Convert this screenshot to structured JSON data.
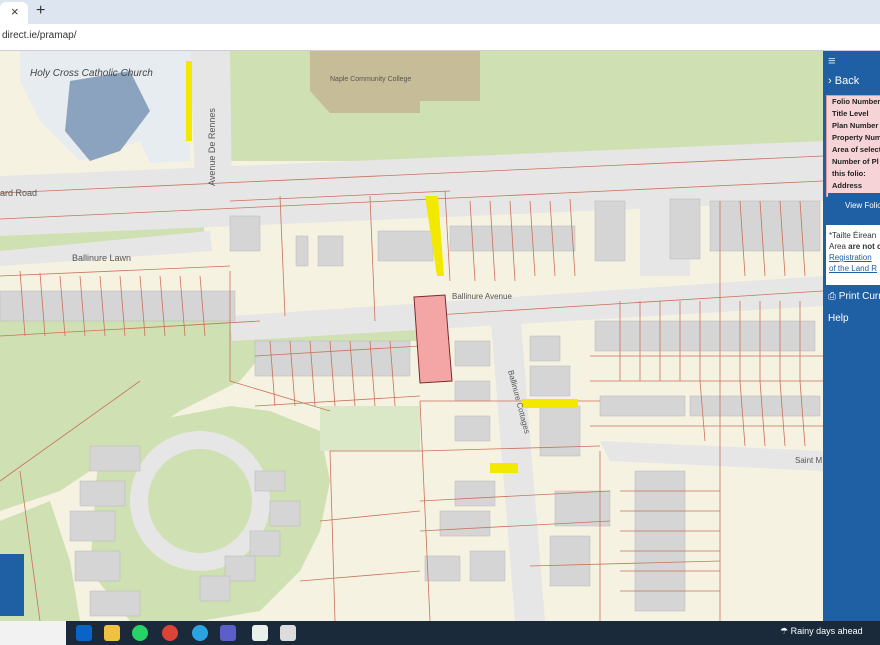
{
  "browser": {
    "tab_close": "×",
    "new_tab": "+",
    "url": "direct.ie/pramap/"
  },
  "map": {
    "labels": {
      "church": "Holy Cross Catholic Church",
      "church_small": "Holy Cross Catholic Church",
      "college": "Naple Community College",
      "road_left": "ard Road",
      "avenue_de_rennes": "Avenue De Rennes",
      "ballinure_lawn": "Ballinure Lawn",
      "ballinure_avenue": "Ballinure Avenue",
      "ballinure_cottages": "Ballinure Cottages",
      "saint_m": "Saint M"
    },
    "colors": {
      "background": "#f6f2e2",
      "green": "#cfe0b2",
      "road": "#e6e6e6",
      "building": "#d5d5d5",
      "parcel_line": "#c9725a",
      "selected": "#f4a6a6",
      "highlight": "#f2e800"
    }
  },
  "panel": {
    "menu_icon": "≡",
    "back": "Back",
    "folio_rows": [
      "Folio Number",
      "Title Level",
      "Plan Number",
      "Property Num",
      "Area of select",
      "Number of Pl",
      "this folio:",
      "Address"
    ],
    "view_folio": "View Folio",
    "note_lines": [
      "*Tailte Éirean",
      "Area are not c"
    ],
    "note_bold": "are not c",
    "note_area": "Area ",
    "note_link1": "Registration",
    "note_link2": "of the Land R",
    "print": "Print Curr",
    "help": "Help"
  },
  "taskbar": {
    "weather": "Rainy days ahead",
    "icons": [
      "outlook-icon",
      "file-explorer-icon",
      "whatsapp-icon",
      "chrome-icon",
      "telegram-icon",
      "teams-icon",
      "notepad-icon",
      "app-icon"
    ]
  }
}
